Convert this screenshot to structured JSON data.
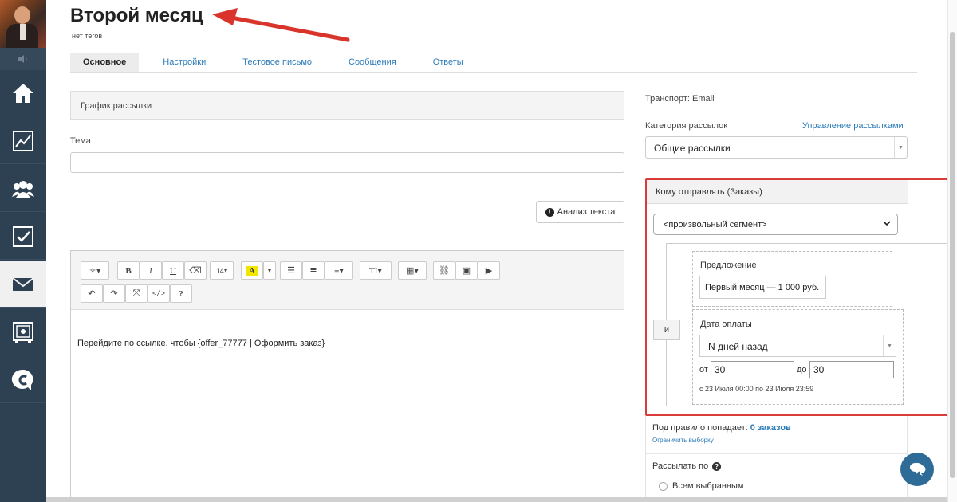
{
  "header": {
    "title": "Второй месяц",
    "tags": "нет тегов"
  },
  "tabs": [
    {
      "label": "Основное"
    },
    {
      "label": "Настройки"
    },
    {
      "label": "Тестовое письмо"
    },
    {
      "label": "Сообщения"
    },
    {
      "label": "Ответы"
    }
  ],
  "left": {
    "schedule_label": "График рассылки",
    "subject_label": "Тема",
    "subject_value": "",
    "analysis_button": "Анализ текста",
    "analysis_icon": "!",
    "font_size": "14",
    "body_text": "Перейдите по ссылке, чтобы {offer_77777 | Оформить заказ}"
  },
  "right": {
    "transport": "Транспорт: Email",
    "category_label": "Категория рассылок",
    "category_link": "Управление рассылками",
    "category_value": "Общие рассылки",
    "rule_title": "Кому отправлять (Заказы)",
    "segment_value": "<произвольный сегмент>",
    "and_label": "и",
    "offer_label": "Предложение",
    "offer_value": "Первый месяц — 1 000 руб.",
    "payment_label": "Дата оплаты",
    "payment_mode": "N дней назад",
    "from_label": "от",
    "from_value": "30",
    "to_label": "до",
    "to_value": "30",
    "range_text": "с 23 Июля 00:00 по 23 Июля 23:59",
    "matches_prefix": "Под правило попадает:",
    "matches_value": "0 заказов",
    "limit_link": "Ограничить выборку",
    "send_by_label": "Рассылать по",
    "send_all_label": "Всем выбранным"
  },
  "colors": {
    "sidebar": "#2e4152",
    "link": "#2a7ab8",
    "highlight_border": "#d93a3a",
    "arrow": "#d9342b"
  }
}
